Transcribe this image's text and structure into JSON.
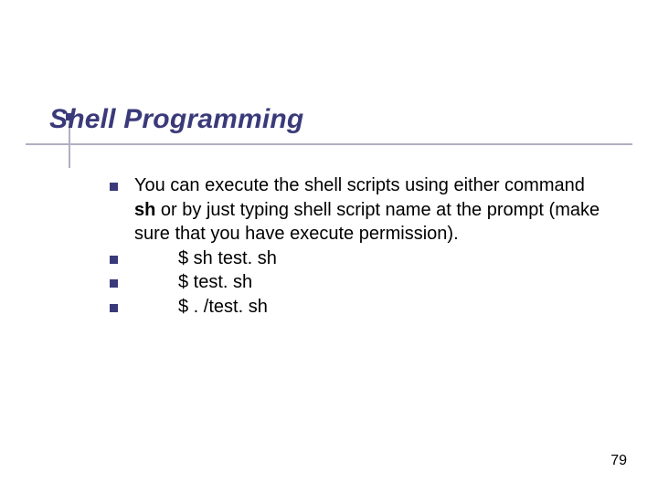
{
  "title": "Shell Programming",
  "body": {
    "main_pre": "You can execute the shell scripts using either command ",
    "main_bold": "sh",
    "main_post": " or by just typing shell script name at the prompt (make sure that you have execute permission).",
    "examples": [
      "$ sh test. sh",
      "$ test. sh",
      "$ . /test. sh"
    ]
  },
  "page_number": "79"
}
